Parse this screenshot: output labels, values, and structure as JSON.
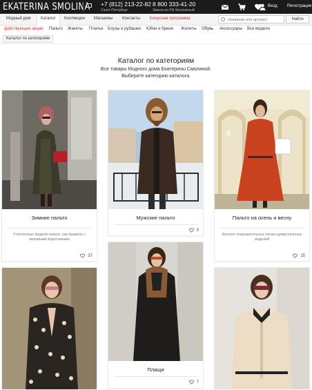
{
  "header": {
    "logo": "EKATERINA SMOLINA",
    "phone1": "+7 (812) 213-22-82",
    "phone1_city": "Санкт-Петербург",
    "phone2": "8 800 333-41-20",
    "phone2_note": "Звонок по РФ бесплатный",
    "login": "Вход",
    "register": "Регистрация",
    "icons": [
      "mail-icon",
      "cart-icon",
      "heart-icon",
      "user-icon"
    ]
  },
  "nav": {
    "items": [
      "Модный дом",
      "Каталог",
      "Коллекции",
      "Магазины",
      "Контакты",
      "Бонусная программа"
    ],
    "active": "Каталог",
    "search_placeholder": "Название или артикул",
    "search_button": "Найти"
  },
  "categories": [
    "Действующие акции",
    "Пальто",
    "Жакеты",
    "Платья",
    "Блузы и рубашки",
    "Юбки и брюки",
    "Жилеты",
    "Обувь",
    "Аксессуары",
    "Все модели"
  ],
  "breadcrumb": "Каталог по категориям",
  "page": {
    "title": "Каталог по категориям",
    "subtitle_line1": "Все товары Модного дома Екатерины Смолиной.",
    "subtitle_line2": "Выберите категорию каталога."
  },
  "cards": [
    {
      "name": "Зимние пальто",
      "desc": "Утепленные модели пальто, как правило с меховыми воротниками",
      "likes": "37"
    },
    {
      "name": "Мужские пальто",
      "desc": "",
      "likes": "0"
    },
    {
      "name": "Пальто на осень и весну",
      "desc": "Каталог очаровательных легких демисезонных моделей",
      "likes": "15"
    },
    {
      "name": "",
      "desc": "",
      "likes": ""
    },
    {
      "name": "Плащи",
      "desc": "",
      "likes": "7"
    },
    {
      "name": "",
      "desc": "",
      "likes": ""
    }
  ],
  "colors": {
    "topbar": "#1b1b1b",
    "accent_red": "#d3313a",
    "nav_bg": "#f4f4f4"
  }
}
